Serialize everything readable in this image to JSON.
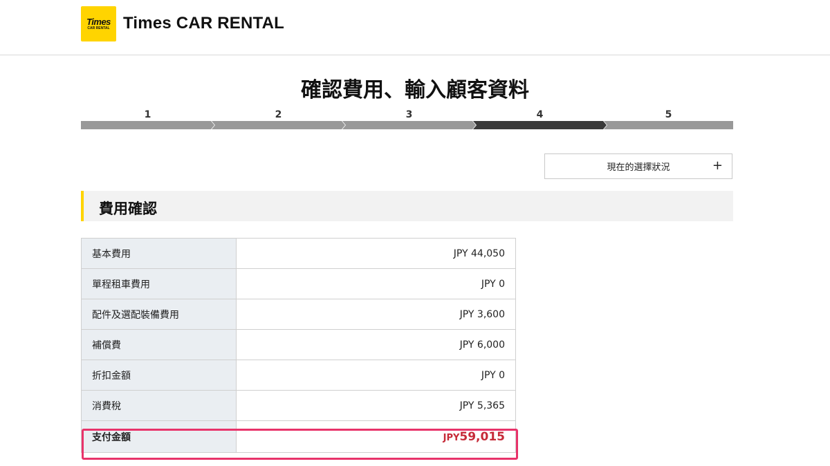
{
  "header": {
    "logo_text": "Times",
    "logo_subtext": "CAR RENTAL",
    "brand_name": "Times CAR RENTAL"
  },
  "page_title": "確認費用、輸入顧客資料",
  "steps": [
    "1",
    "2",
    "3",
    "4",
    "5"
  ],
  "active_step": 4,
  "status_button": {
    "label": "現在的選擇狀況",
    "icon": "plus-icon"
  },
  "section_title": "費用確認",
  "fees": [
    {
      "label": "基本費用",
      "value": "JPY 44,050"
    },
    {
      "label": "單程租車費用",
      "value": "JPY 0"
    },
    {
      "label": "配件及選配裝備費用",
      "value": "JPY 3,600"
    },
    {
      "label": "補償費",
      "value": "JPY 6,000"
    },
    {
      "label": "折扣金額",
      "value": "JPY 0"
    },
    {
      "label": "消費稅",
      "value": "JPY 5,365"
    }
  ],
  "total": {
    "label": "支付金額",
    "currency": "JPY",
    "amount": "59,015"
  },
  "colors": {
    "brand_yellow": "#ffd400",
    "active_step": "#3a3a3a",
    "inactive_step": "#999999",
    "total_text": "#c62a38",
    "highlight_border": "#e8336a"
  }
}
